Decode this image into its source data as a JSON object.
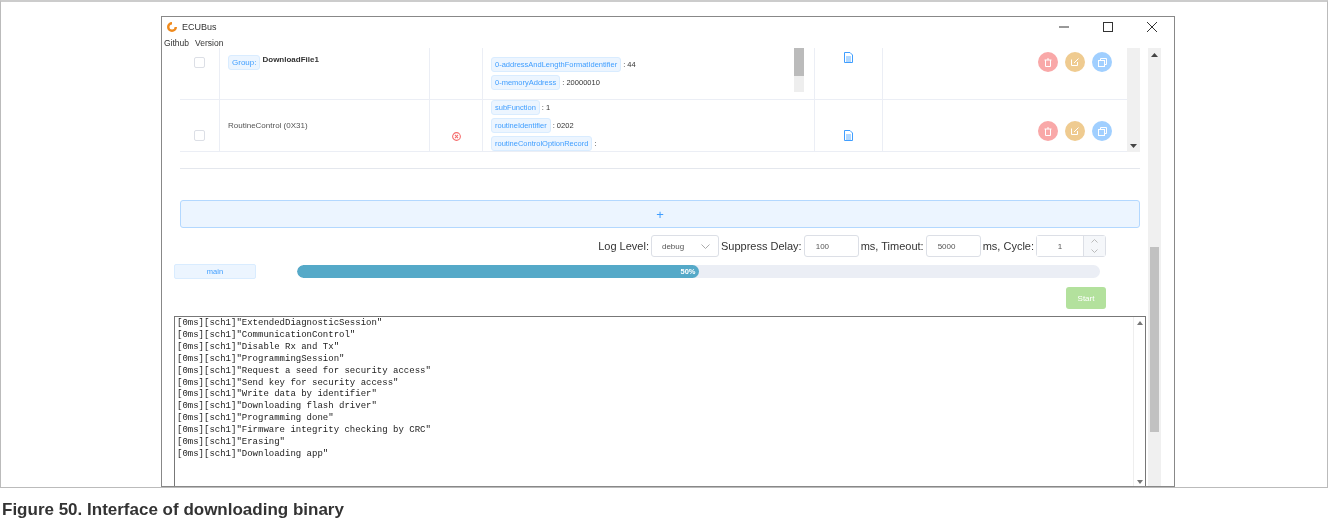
{
  "window": {
    "title": "ECUBus"
  },
  "menu": [
    "Github",
    "Version"
  ],
  "steps": [
    {
      "kind": "group",
      "checked": false,
      "group_label": "Group:",
      "name": "DownloadFile1",
      "error": false,
      "params": [
        {
          "key": "0-addressAndLengthFormatIdentifier",
          "value": ": 44"
        },
        {
          "key": "0-memoryAddress",
          "value": ": 20000010"
        }
      ]
    },
    {
      "kind": "service",
      "checked": false,
      "name": "RoutineControl (0X31)",
      "error": true,
      "params": [
        {
          "key": "subFunction",
          "value": ": 1"
        },
        {
          "key": "routineIdentifier",
          "value": ": 0202"
        },
        {
          "key": "routineControlOptionRecord",
          "value": ":"
        }
      ]
    }
  ],
  "add_button": "+",
  "options": {
    "log_level_label": "Log Level:",
    "log_level": "debug",
    "suppress_label": "Suppress Delay:",
    "suppress": "100",
    "timeout_label": "ms, Timeout:",
    "timeout": "5000",
    "cycle_label": "ms, Cycle:",
    "cycle": "1"
  },
  "progress": {
    "tag": "main",
    "level": 0.5,
    "reading": "50%"
  },
  "start_button": {
    "label": "Start",
    "disabled": true
  },
  "log": [
    "[0ms][sch1]\"ExtendedDiagnosticSession\"",
    "[0ms][sch1]\"CommunicationControl\"",
    "[0ms][sch1]\"Disable Rx and Tx\"",
    "[0ms][sch1]\"ProgrammingSession\"",
    "[0ms][sch1]\"Request a seed for security access\"",
    "[0ms][sch1]\"Send key for security access\"",
    "[0ms][sch1]\"Write data by identifier\"",
    "[0ms][sch1]\"Downloading flash driver\"",
    "[0ms][sch1]\"Programming done\"",
    "[0ms][sch1]\"Firmware integrity checking by CRC\"",
    "[0ms][sch1]\"Erasing\"",
    "[0ms][sch1]\"Downloading app\""
  ],
  "caption": "Figure 50.  Interface of downloading binary"
}
